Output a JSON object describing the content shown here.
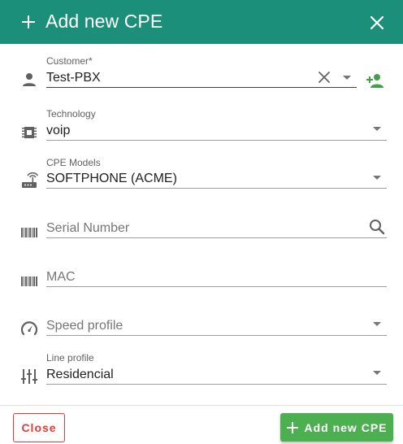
{
  "dialog": {
    "title": "Add new CPE",
    "header_color": "#1b8f7a",
    "header_icons": [
      "plus-icon",
      "close-icon"
    ]
  },
  "fields": {
    "customer": {
      "label": "Customer*",
      "value": "Test-PBX",
      "icon": "person-icon",
      "add_icon": "person-add-icon"
    },
    "technology": {
      "label": "Technology",
      "value": "voip",
      "icon": "memory-chip-icon"
    },
    "cpe_models": {
      "label": "CPE Models",
      "value": "SOFTPHONE (ACME)",
      "icon": "router-icon"
    },
    "serial_number": {
      "placeholder": "Serial Number",
      "icon": "barcode-icon",
      "action_icon": "search-icon"
    },
    "mac": {
      "placeholder": "MAC",
      "icon": "barcode-icon"
    },
    "speed_profile": {
      "placeholder": "Speed profile",
      "icon": "speed-gauge-icon"
    },
    "line_profile": {
      "label": "Line profile",
      "value": "Residencial",
      "icon": "tune-icon"
    }
  },
  "footer": {
    "close_label": "Close",
    "add_label": "Add new CPE",
    "close_color": "#e53935",
    "add_color": "#4caf50"
  }
}
